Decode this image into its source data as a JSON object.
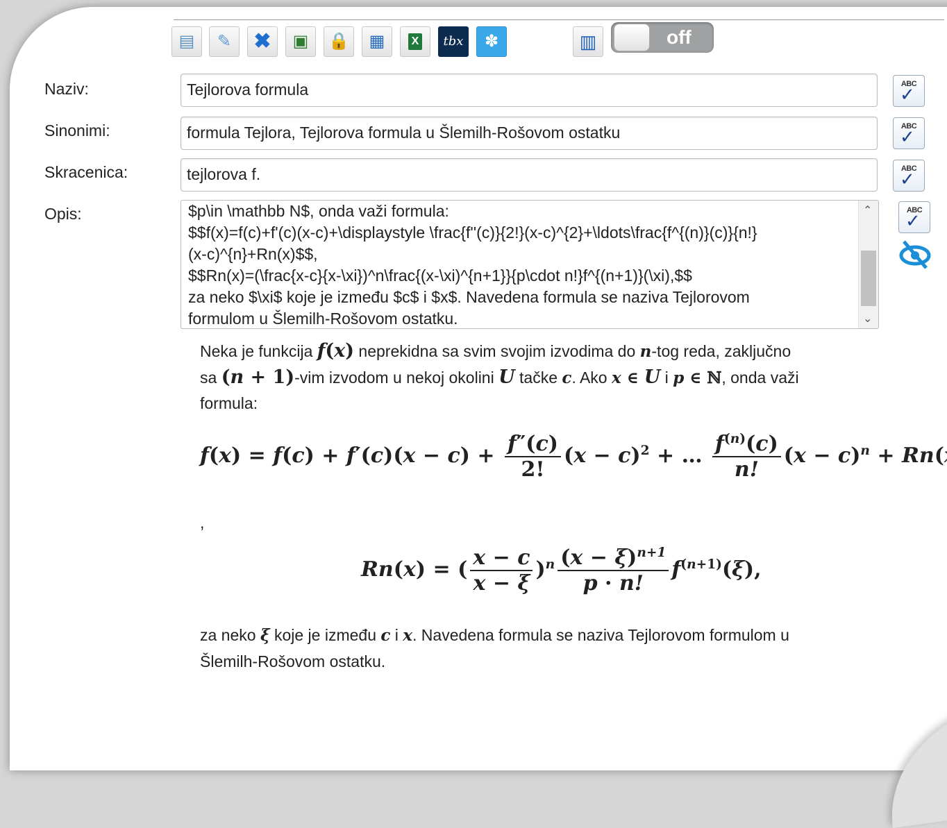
{
  "toolbar": {
    "icons": [
      "add-icon",
      "edit-icon",
      "delete-icon",
      "save-icon",
      "lock-icon",
      "table-icon",
      "excel-icon",
      "tbx-icon",
      "tree-icon",
      "book-icon"
    ],
    "tbx_text": "tbx",
    "toggle_state": "off"
  },
  "form": {
    "naziv": {
      "label": "Naziv:",
      "value": "Tejlorova formula"
    },
    "sinonimi": {
      "label": "Sinonimi:",
      "value": "formula Tejlora, Tejlorova formula u Šlemilh-Rošovom ostatku"
    },
    "skracenica": {
      "label": "Skracenica:",
      "value": "tejlorova f."
    },
    "opis": {
      "label": "Opis:",
      "value": "$p\\in \\mathbb N$, onda važi formula:\n$$f(x)=f(c)+f'(c)(x-c)+\\displaystyle \\frac{f''(c)}{2!}(x-c)^{2}+\\ldots\\frac{f^{(n)}(c)}{n!}\n(x-c)^{n}+Rn(x)$$,\n$$Rn(x)=(\\frac{x-c}{x-\\xi})^n\\frac{(x-\\xi)^{n+1}}{p\\cdot n!}f^{(n+1)}(\\xi),$$\nza neko $\\xi$ koje je između $c$ i $x$. Navedena formula se naziva Tejlorovom\nformulom u Šlemilh-Rošovom ostatku."
    }
  },
  "preview": {
    "p1_a": "Neka je funkcija ",
    "p1_b": " neprekidna sa svim svojim izvodima do ",
    "p1_c": "-tog reda, zaključno",
    "p1_d": "sa ",
    "p1_e": "-vim izvodom u nekoj okolini ",
    "p1_f": " tačke ",
    "p1_g": ". Ako ",
    "p1_h": " i ",
    "p1_i": ", onda važi",
    "p1_j": "formula:",
    "comma": ",",
    "p2_a": "za neko ",
    "p2_b": " koje je između ",
    "p2_c": " i ",
    "p2_d": ". Navedena formula se naziva Tejlorovom formulom u",
    "p2_e": "Šlemilh-Rošovom ostatku."
  }
}
